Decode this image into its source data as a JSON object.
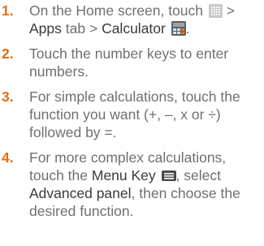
{
  "steps": [
    {
      "number": "1.",
      "parts": {
        "a": "On the Home screen, touch",
        "b": ">",
        "c": "Apps",
        "d": "tab >",
        "e": "Calculator",
        "f": "."
      }
    },
    {
      "number": "2.",
      "text": "Touch the number keys to enter numbers."
    },
    {
      "number": "3.",
      "text": "For simple calculations, touch the function you want (+, –, x or ÷) followed by =."
    },
    {
      "number": "4.",
      "parts": {
        "a": "For more complex calculations, touch the",
        "b": "Menu Key",
        "c": ", select",
        "d": "Advanced panel",
        "e": ", then choose the desired function."
      }
    }
  ],
  "icons": {
    "apps": "apps-grid-icon",
    "calculator": "calculator-app-icon",
    "menu_key": "menu-key-icon"
  },
  "colors": {
    "number": "#e36d10",
    "body_text": "#6f6f6f",
    "ui_text": "#3a3a3a"
  }
}
